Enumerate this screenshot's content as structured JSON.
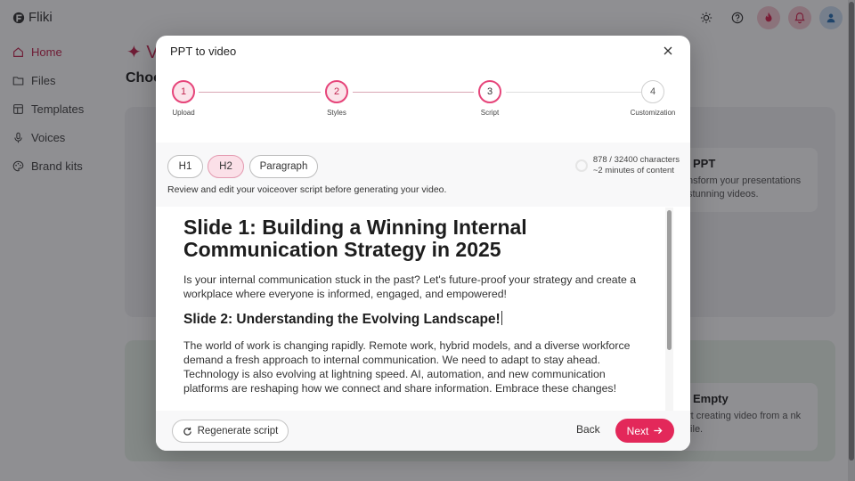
{
  "app": {
    "name": "Fliki"
  },
  "sidebar": {
    "items": [
      {
        "label": "Home",
        "icon": "home-icon",
        "active": true
      },
      {
        "label": "Files",
        "icon": "folder-icon"
      },
      {
        "label": "Templates",
        "icon": "template-icon"
      },
      {
        "label": "Voices",
        "icon": "microphone-icon"
      },
      {
        "label": "Brand kits",
        "icon": "palette-icon"
      }
    ]
  },
  "background": {
    "heading_fragment": "✦ V",
    "choose_fragment": "Choo",
    "card_ppt": {
      "title": "PPT",
      "desc": "nsform your presentations stunning videos."
    },
    "card_empty": {
      "title": "Empty",
      "desc": "rt creating video from a nk file."
    }
  },
  "modal": {
    "title": "PPT to video",
    "steps": [
      {
        "number": "1",
        "label": "Upload",
        "state": "done"
      },
      {
        "number": "2",
        "label": "Styles",
        "state": "done"
      },
      {
        "number": "3",
        "label": "Script",
        "state": "current"
      },
      {
        "number": "4",
        "label": "Customization",
        "state": "todo"
      }
    ],
    "format_buttons": {
      "h1": "H1",
      "h2": "H2",
      "paragraph": "Paragraph"
    },
    "review_text": "Review and edit your voiceover script before generating your video.",
    "char_count": "878 / 32400 characters",
    "duration": "~2 minutes of content",
    "script": {
      "h1": "Slide 1: Building a Winning Internal Communication Strategy in 2025",
      "p1": "Is your internal communication stuck in the past? Let's future-proof your strategy and create a workplace where everyone is informed, engaged, and empowered!",
      "h2": "Slide 2: Understanding the Evolving Landscape!",
      "p2": "The world of work is changing rapidly. Remote work, hybrid models, and a diverse workforce demand a fresh approach to internal communication. We need to adapt to stay ahead. Technology is also evolving at lightning speed. AI, automation, and new communication platforms are reshaping how we connect and share information. Embrace these changes!"
    },
    "footer": {
      "regenerate": "Regenerate script",
      "back": "Back",
      "next": "Next"
    }
  },
  "colors": {
    "accent": "#e3285a",
    "accent_light": "#fbe0e8"
  }
}
